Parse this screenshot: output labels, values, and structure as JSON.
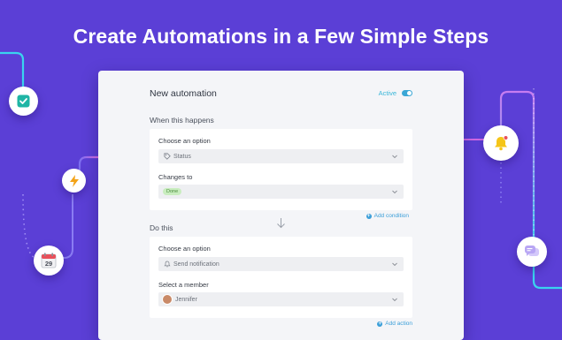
{
  "headline": "Create Automations in a Few Simple Steps",
  "calendar_badge": {
    "day": "29"
  },
  "card": {
    "title": "New automation",
    "active_label": "Active",
    "trigger": {
      "section_label": "When this happens",
      "field1_label": "Choose an option",
      "field1_value": "Status",
      "field2_label": "Changes to",
      "field2_value": "Done",
      "add_link": "Add condition"
    },
    "action": {
      "section_label": "Do this",
      "field1_label": "Choose an option",
      "field1_value": "Send notification",
      "field2_label": "Select a member",
      "field2_value": "Jennifer",
      "add_link": "Add action"
    }
  },
  "colors": {
    "background": "#5b3fd6",
    "accent_cyan": "#3ad3ef",
    "accent_pink": "#d46ae6",
    "link_blue": "#3a9ed8",
    "done_pill": "#c9edbf",
    "bell_yellow": "#f5c518",
    "lightning_orange": "#f3a318",
    "check_teal": "#1fb5a5",
    "chat_purple": "#b8a6f4"
  },
  "icons": [
    "check-icon",
    "lightning-icon",
    "calendar-icon",
    "bell-icon",
    "chat-icon",
    "tag-icon",
    "chevron-down-icon",
    "arrow-down-icon",
    "plus-icon"
  ]
}
